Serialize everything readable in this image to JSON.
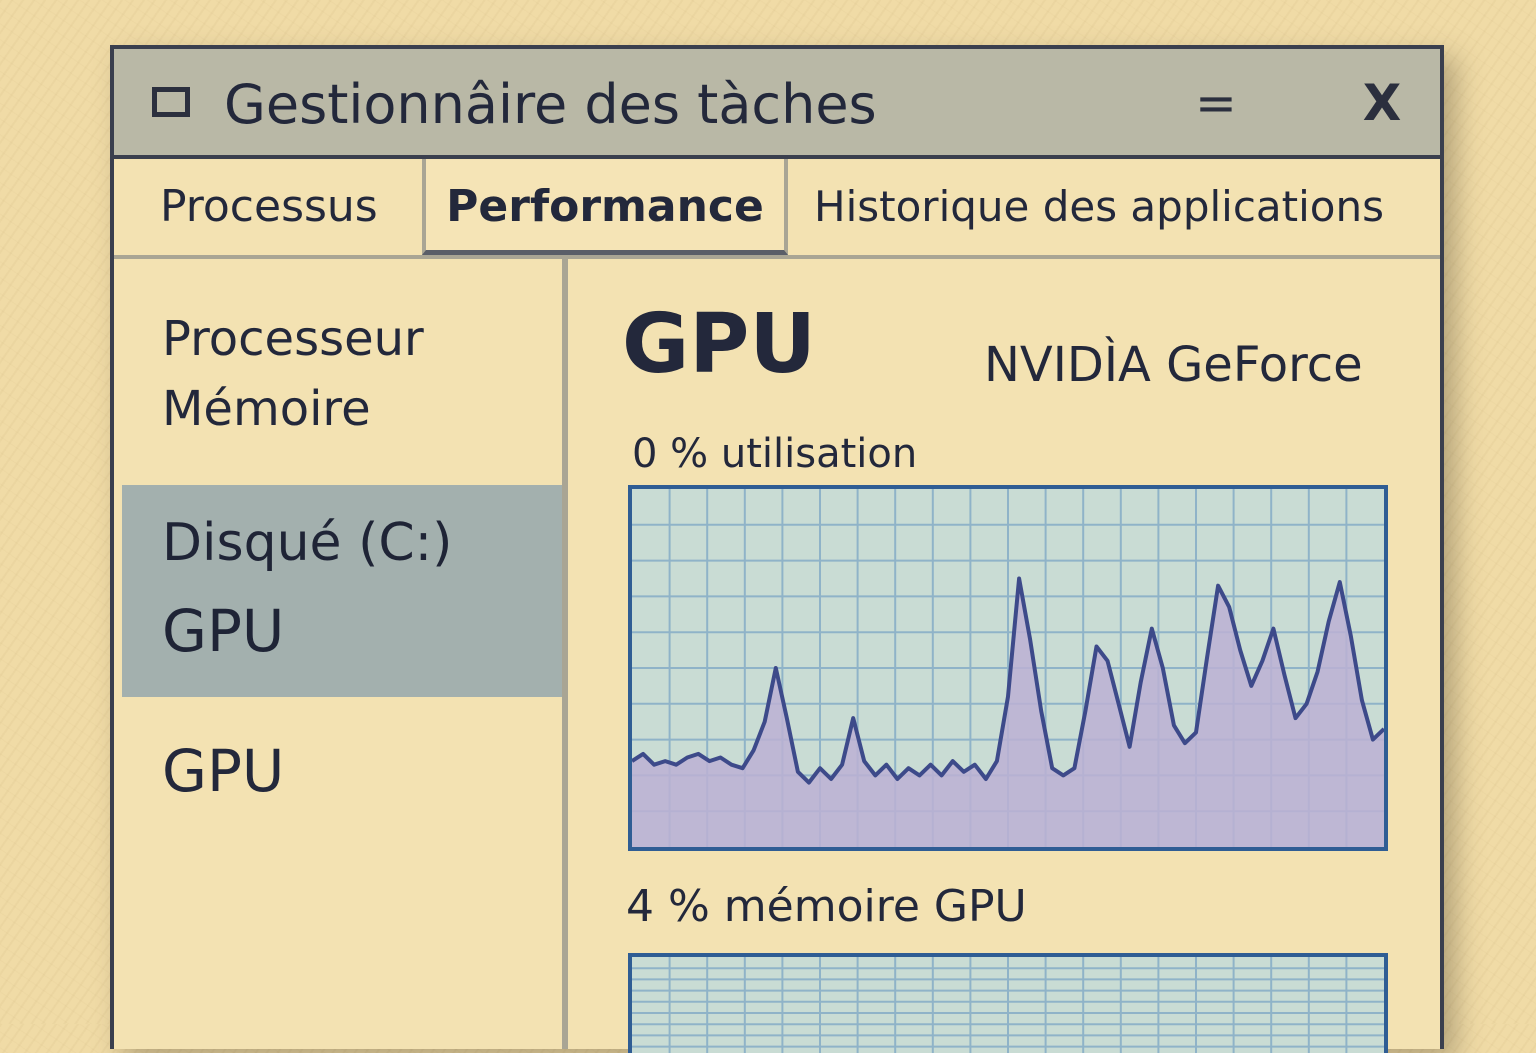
{
  "window": {
    "title": "Gestionnâire  des tàches",
    "minimize_symbol": "=",
    "close_symbol": "X",
    "app_icon": "window-icon"
  },
  "tabs": [
    {
      "label": "Processus",
      "selected": false
    },
    {
      "label": "Performance",
      "selected": true
    },
    {
      "label": "Historique des applications",
      "selected": false
    }
  ],
  "sidebar": {
    "items": [
      {
        "label": "Processeur"
      },
      {
        "label": "Mémoire"
      },
      {
        "label": "Disqué (C:)"
      },
      {
        "label": "GPU"
      },
      {
        "label": "GPU"
      }
    ],
    "selected_index": [
      2,
      3
    ]
  },
  "main": {
    "title": "GPU",
    "model": "NVIDÌA GeForce",
    "utilisation_label": "0 % utilisation",
    "memory_label": "4 % mémoire GPU"
  },
  "colors": {
    "background": "#f0dba6",
    "titlebar": "#b9b8a6",
    "selected_item": "#a3b0ae",
    "graph_fill": "#bcb0d4",
    "graph_bg": "#c9dcd4",
    "graph_line": "#3d4a8a",
    "graph_border": "#2f5d94",
    "grid": "#8fb3c8"
  },
  "chart_data": [
    {
      "type": "area",
      "x_range": [
        0,
        60
      ],
      "ylim": [
        0,
        100
      ],
      "grid": true,
      "values": [
        24,
        26,
        23,
        24,
        23,
        25,
        26,
        24,
        25,
        23,
        22,
        27,
        35,
        50,
        36,
        21,
        18,
        22,
        19,
        23,
        36,
        24,
        20,
        23,
        19,
        22,
        20,
        23,
        20,
        24,
        21,
        23,
        19,
        24,
        42,
        75,
        58,
        38,
        22,
        20,
        22,
        38,
        56,
        52,
        40,
        28,
        46,
        61,
        50,
        34,
        29,
        32,
        53,
        73,
        67,
        55,
        45,
        52,
        61,
        48,
        36,
        40,
        49,
        63,
        74,
        59,
        41,
        30,
        33
      ]
    },
    {
      "type": "area",
      "x_range": [
        0,
        60
      ],
      "ylim": [
        0,
        100
      ],
      "grid": true,
      "values": []
    }
  ]
}
